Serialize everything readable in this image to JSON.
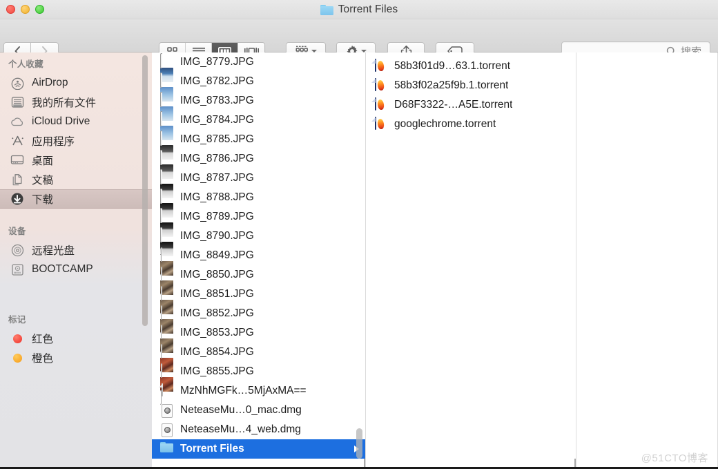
{
  "window": {
    "title": "Torrent Files",
    "title_icon": "folder-icon",
    "traffic_lights": [
      {
        "name": "close-button",
        "color": "#f0483f"
      },
      {
        "name": "minimize-button",
        "color": "#f0b32c"
      },
      {
        "name": "maximize-button",
        "color": "#3bc72f"
      }
    ]
  },
  "toolbar": {
    "back_label": "‹",
    "forward_label": "›",
    "view_modes": [
      {
        "name": "icon-view",
        "icon": "grid-icon",
        "active": false
      },
      {
        "name": "list-view",
        "icon": "list-icon",
        "active": false
      },
      {
        "name": "column-view",
        "icon": "columns-icon",
        "active": true
      },
      {
        "name": "coverflow-view",
        "icon": "coverflow-icon",
        "active": false
      }
    ],
    "arrange_icon": "arrange-icon",
    "action_icon": "gear-icon",
    "share_icon": "share-icon",
    "tag_icon": "tag-icon"
  },
  "search": {
    "placeholder": "搜索",
    "value": "",
    "icon": "search-icon"
  },
  "sidebar": {
    "sections": [
      {
        "header": "个人收藏",
        "items": [
          {
            "label": "AirDrop",
            "icon": "airdrop-icon",
            "selected": false
          },
          {
            "label": "我的所有文件",
            "icon": "all-my-files-icon",
            "selected": false
          },
          {
            "label": "iCloud Drive",
            "icon": "icloud-icon",
            "selected": false
          },
          {
            "label": "应用程序",
            "icon": "applications-icon",
            "selected": false
          },
          {
            "label": "桌面",
            "icon": "desktop-icon",
            "selected": false
          },
          {
            "label": "文稿",
            "icon": "documents-icon",
            "selected": false
          },
          {
            "label": "下载",
            "icon": "downloads-icon",
            "selected": true
          }
        ]
      },
      {
        "header": "设备",
        "items": [
          {
            "label": "远程光盘",
            "icon": "remote-disc-icon",
            "selected": false
          },
          {
            "label": "BOOTCAMP",
            "icon": "hard-drive-icon",
            "selected": false
          }
        ]
      },
      {
        "header": "标记",
        "items": [
          {
            "label": "红色",
            "icon": "tag-dot-icon",
            "color": "#f0413a",
            "selected": false
          },
          {
            "label": "橙色",
            "icon": "tag-dot-icon",
            "color": "#f5a623",
            "selected": false
          }
        ]
      }
    ]
  },
  "columns": [
    {
      "name": "downloads-column",
      "items": [
        {
          "label": "IMG_8779.JPG",
          "icon": "photo-icon",
          "variant": "sky2",
          "selected": false
        },
        {
          "label": "IMG_8782.JPG",
          "icon": "photo-icon",
          "variant": "sky",
          "selected": false
        },
        {
          "label": "IMG_8783.JPG",
          "icon": "photo-icon",
          "variant": "sky",
          "selected": false
        },
        {
          "label": "IMG_8784.JPG",
          "icon": "photo-icon",
          "variant": "sky",
          "selected": false
        },
        {
          "label": "IMG_8785.JPG",
          "icon": "photo-icon",
          "variant": "dark",
          "selected": false
        },
        {
          "label": "IMG_8786.JPG",
          "icon": "photo-icon",
          "variant": "dark",
          "selected": false
        },
        {
          "label": "IMG_8787.JPG",
          "icon": "photo-icon",
          "variant": "dark2",
          "selected": false
        },
        {
          "label": "IMG_8788.JPG",
          "icon": "photo-icon",
          "variant": "dark2",
          "selected": false
        },
        {
          "label": "IMG_8789.JPG",
          "icon": "photo-icon",
          "variant": "dark2",
          "selected": false
        },
        {
          "label": "IMG_8790.JPG",
          "icon": "photo-icon",
          "variant": "dark2",
          "selected": false
        },
        {
          "label": "IMG_8849.JPG",
          "icon": "portrait-photo-icon",
          "variant": "brown",
          "selected": false
        },
        {
          "label": "IMG_8850.JPG",
          "icon": "portrait-photo-icon",
          "variant": "brown",
          "selected": false
        },
        {
          "label": "IMG_8851.JPG",
          "icon": "portrait-photo-icon",
          "variant": "brown",
          "selected": false
        },
        {
          "label": "IMG_8852.JPG",
          "icon": "portrait-photo-icon",
          "variant": "brown",
          "selected": false
        },
        {
          "label": "IMG_8853.JPG",
          "icon": "portrait-photo-icon",
          "variant": "brown",
          "selected": false
        },
        {
          "label": "IMG_8854.JPG",
          "icon": "portrait-photo-icon",
          "variant": "red",
          "selected": false
        },
        {
          "label": "IMG_8855.JPG",
          "icon": "portrait-photo-icon",
          "variant": "red",
          "selected": false
        },
        {
          "label": "MzNhMGFk…5MjAxMA==",
          "icon": "generic-document-icon",
          "variant": "",
          "selected": false
        },
        {
          "label": "NeteaseMu…0_mac.dmg",
          "icon": "disk-image-icon",
          "variant": "",
          "selected": false
        },
        {
          "label": "NeteaseMu…4_web.dmg",
          "icon": "disk-image-icon",
          "variant": "",
          "selected": false
        },
        {
          "label": "Torrent Files",
          "icon": "folder-icon",
          "variant": "",
          "selected": true
        }
      ]
    },
    {
      "name": "torrent-files-column",
      "items": [
        {
          "label": "58b3f01d9…63.1.torrent",
          "icon": "torrent-file-icon",
          "variant": "",
          "selected": false
        },
        {
          "label": "58b3f02a25f9b.1.torrent",
          "icon": "torrent-file-icon",
          "variant": "",
          "selected": false
        },
        {
          "label": "D68F3322-…A5E.torrent",
          "icon": "torrent-file-icon",
          "variant": "",
          "selected": false
        },
        {
          "label": "googlechrome.torrent",
          "icon": "torrent-file-icon",
          "variant": "",
          "selected": false
        }
      ]
    }
  ],
  "watermark": "@51CTO博客"
}
